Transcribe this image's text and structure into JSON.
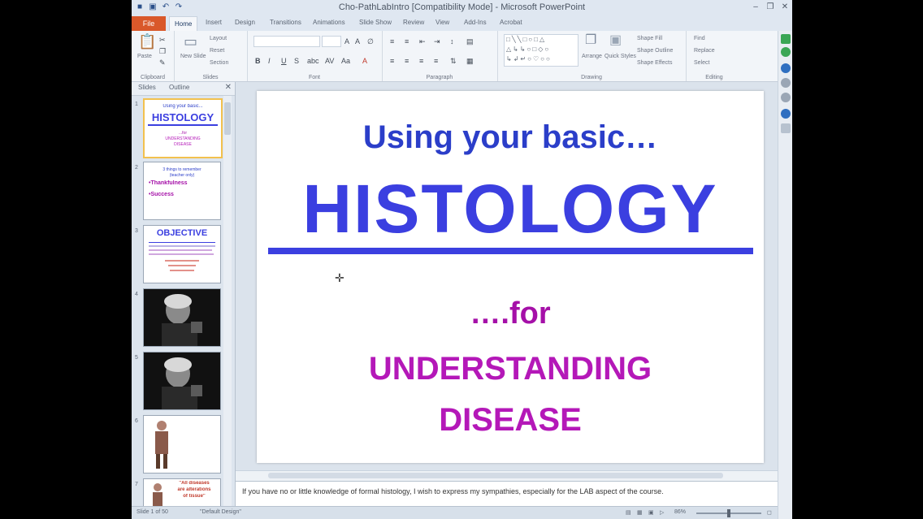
{
  "window": {
    "title": "Cho-PathLabIntro [Compatibility Mode] - Microsoft PowerPoint"
  },
  "ribbon": {
    "file_tab": "File",
    "tabs": [
      "Home",
      "Insert",
      "Design",
      "Transitions",
      "Animations",
      "Slide Show",
      "Review",
      "View",
      "Add-Ins",
      "Acrobat"
    ],
    "groups": {
      "clipboard": "Clipboard",
      "slides": "Slides",
      "font": "Font",
      "paragraph": "Paragraph",
      "drawing": "Drawing",
      "editing": "Editing"
    },
    "buttons": {
      "paste": "Paste",
      "new_slide": "New Slide",
      "layout": "Layout",
      "reset": "Reset",
      "section": "Section",
      "arrange": "Arrange",
      "quick_styles": "Quick Styles",
      "shape_fill": "Shape Fill",
      "shape_outline": "Shape Outline",
      "shape_effects": "Shape Effects",
      "find": "Find",
      "replace": "Replace",
      "select": "Select"
    }
  },
  "pane": {
    "tab_slides": "Slides",
    "tab_outline": "Outline",
    "thumbnails": [
      {
        "number": "1",
        "lines": [
          "Using your basic...",
          "HISTOLOGY",
          "...for",
          "UNDERSTANDING",
          "DISEASE"
        ]
      },
      {
        "number": "2",
        "lines": [
          "3 things to remember",
          "(teacher only)",
          "•Thankfulness",
          "•Success"
        ]
      },
      {
        "number": "3",
        "lines": [
          "OBJECTIVE"
        ]
      },
      {
        "number": "4",
        "lines": []
      },
      {
        "number": "5",
        "lines": []
      },
      {
        "number": "6",
        "lines": []
      },
      {
        "number": "7",
        "lines": [
          "\"All diseases",
          "are alterations",
          "of tissue\""
        ]
      }
    ]
  },
  "slide": {
    "line1": "Using your basic…",
    "line2": "HISTOLOGY",
    "line3": "….for",
    "line4": "UNDERSTANDING",
    "line5": "DISEASE"
  },
  "notes": {
    "text": "If you have no or little knowledge of formal histology, I wish to express my sympathies, especially for the LAB aspect of the course."
  },
  "status": {
    "slide_info": "Slide 1 of 50",
    "theme": "\"Default Design\"",
    "zoom": "86%"
  },
  "colors": {
    "title_blue": "#3b3fe0",
    "subtitle_magenta": "#b418b8",
    "file_tab": "#d9582a"
  }
}
